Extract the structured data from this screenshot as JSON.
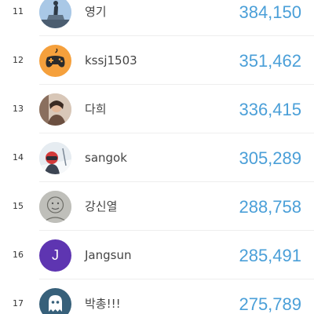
{
  "leaderboard": {
    "rows": [
      {
        "rank": "11",
        "name": "영기",
        "score": "384,150",
        "avatar": {
          "icon": "photo-monument-icon",
          "color": "#6a8fb5"
        }
      },
      {
        "rank": "12",
        "name": "kssj1503",
        "score": "351,462",
        "avatar": {
          "icon": "gamepad-icon",
          "color": "#f5a03c"
        }
      },
      {
        "rank": "13",
        "name": "다희",
        "score": "336,415",
        "avatar": {
          "icon": "photo-person-icon",
          "color": "#b89c8a"
        }
      },
      {
        "rank": "14",
        "name": "sangok",
        "score": "305,289",
        "avatar": {
          "icon": "photo-skier-icon",
          "color": "#c9d3dc"
        }
      },
      {
        "rank": "15",
        "name": "강신열",
        "score": "288,758",
        "avatar": {
          "icon": "photo-sketch-icon",
          "color": "#b5b5b0"
        }
      },
      {
        "rank": "16",
        "name": "Jangsun",
        "score": "285,491",
        "avatar": {
          "letter": "J",
          "icon": "letter-avatar-icon",
          "color": "#5e35b1"
        }
      },
      {
        "rank": "17",
        "name": "박총!!!",
        "score": "275,789",
        "avatar": {
          "icon": "ghost-icon",
          "color": "#37607a"
        }
      }
    ]
  }
}
